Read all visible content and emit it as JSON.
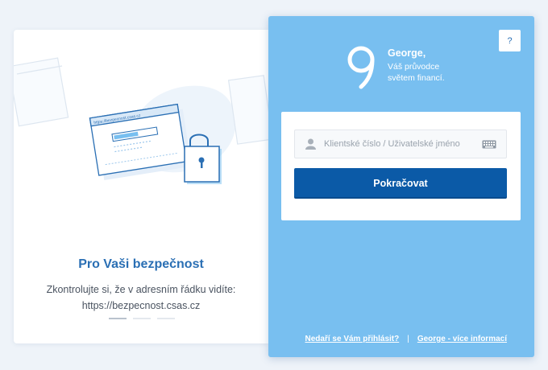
{
  "promo": {
    "title": "Pro Vaši bezpečnost",
    "line1": "Zkontrolujte si, že v adresním řádku vidíte:",
    "line2": "https://bezpecnost.csas.cz",
    "illustration_url_text": "https://bezpecnost.csas.cz"
  },
  "help": {
    "label": "?"
  },
  "brand": {
    "name": "George,",
    "tagline_line1": "Váš průvodce",
    "tagline_line2": "světem financí."
  },
  "login": {
    "placeholder": "Klientské číslo / Uživatelské jméno",
    "value": "",
    "submit_label": "Pokračovat",
    "user_icon": "user-icon",
    "keyboard_icon": "keyboard-icon"
  },
  "footer": {
    "trouble_link": "Nedaří se Vám přihlásit?",
    "separator": "|",
    "info_link": "George - více informací"
  },
  "colors": {
    "panel": "#78bff0",
    "button": "#0b5aa7",
    "title": "#2a6fb4",
    "background": "#eef3f9"
  }
}
